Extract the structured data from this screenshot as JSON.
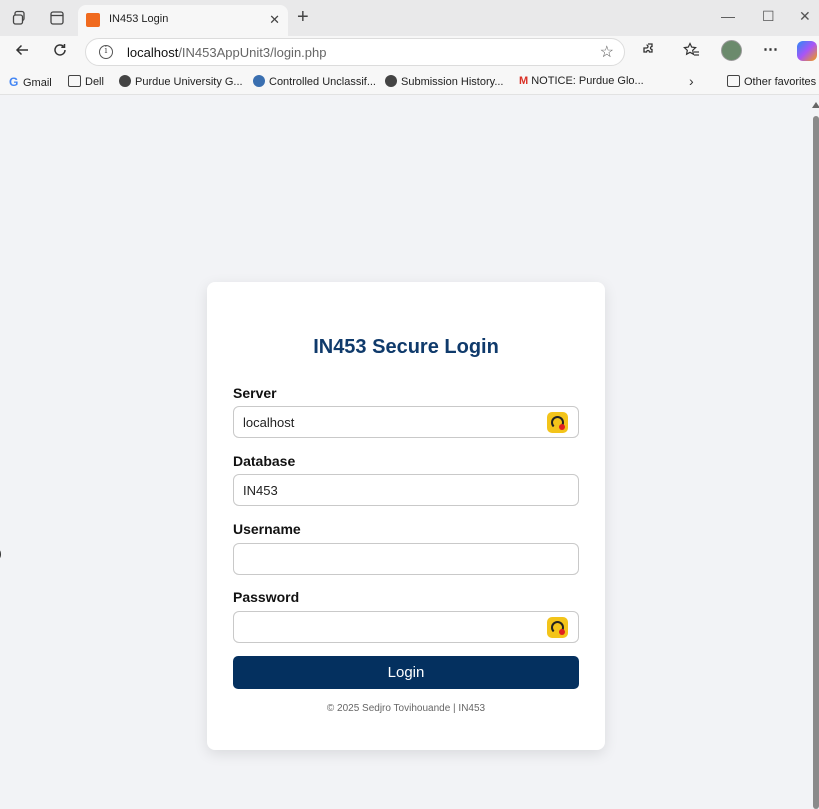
{
  "browser": {
    "tab": {
      "title": "IN453 Login",
      "close": "✕"
    },
    "new_tab": "+",
    "window_controls": {
      "minimize": "—",
      "maximize": "☐",
      "close": "✕"
    },
    "address": {
      "host": "localhost",
      "path": "/IN453AppUnit3/login.php"
    },
    "bookmarks": [
      {
        "label": "Gmail",
        "icon": "google-icon"
      },
      {
        "label": "Dell",
        "icon": "folder-icon"
      },
      {
        "label": "Purdue University G...",
        "icon": "purdue-icon"
      },
      {
        "label": "Controlled Unclassif...",
        "icon": "cui-icon"
      },
      {
        "label": "Submission History...",
        "icon": "purdue-icon"
      },
      {
        "label": "NOTICE: Purdue Glo...",
        "icon": "gmail-icon"
      }
    ],
    "other_favorites": "Other favorites"
  },
  "login": {
    "title": "IN453 Secure Login",
    "server": {
      "label": "Server",
      "value": "localhost"
    },
    "database": {
      "label": "Database",
      "value": "IN453"
    },
    "username": {
      "label": "Username",
      "value": ""
    },
    "password": {
      "label": "Password",
      "value": ""
    },
    "submit": "Login",
    "footer": "© 2025 Sedjro Tovihouande | IN453"
  },
  "colors": {
    "primary": "#04305f",
    "title": "#0f3a6b",
    "page_bg": "#f2f3f6"
  }
}
